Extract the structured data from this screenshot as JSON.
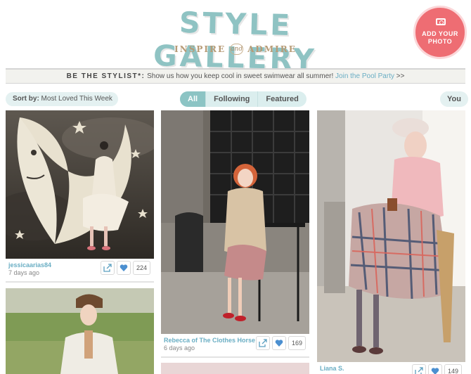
{
  "header": {
    "title": "STYLE GALLERY",
    "tagline_left": "INSPIRE",
    "tagline_amp": "and",
    "tagline_right": "ADMIRE",
    "add_photo_line1": "ADD YOUR",
    "add_photo_line2": "PHOTO"
  },
  "announcement": {
    "lead": "BE THE STYLIST*:",
    "text": " Show us how you keep cool in sweet swimwear all summer! ",
    "link": "Join the Pool Party",
    "suffix": " >>"
  },
  "filters": {
    "sort_label": "Sort by:",
    "sort_value": " Most Loved This Week",
    "tabs": [
      "All",
      "Following",
      "Featured"
    ],
    "active_tab": "All",
    "you_label": "You"
  },
  "posts": [
    {
      "username": "jessicaarias84",
      "date": "7 days ago",
      "loves": "224"
    },
    {
      "username": "Rebecca of The Clothes Horse",
      "date": "6 days ago",
      "loves": "169"
    },
    {
      "username": "Liana S.",
      "date": "",
      "loves": "149"
    },
    {
      "username": "",
      "date": "",
      "loves": ""
    }
  ],
  "colors": {
    "brand_teal": "#8fc3c3",
    "link_blue": "#6aaec4",
    "add_photo_red": "#ee6d73",
    "tagline_gold": "#b79b76"
  },
  "icons": {
    "share": "share-icon",
    "love": "heart-icon",
    "camera": "camera-icon",
    "caret": "chevron-down-icon"
  }
}
